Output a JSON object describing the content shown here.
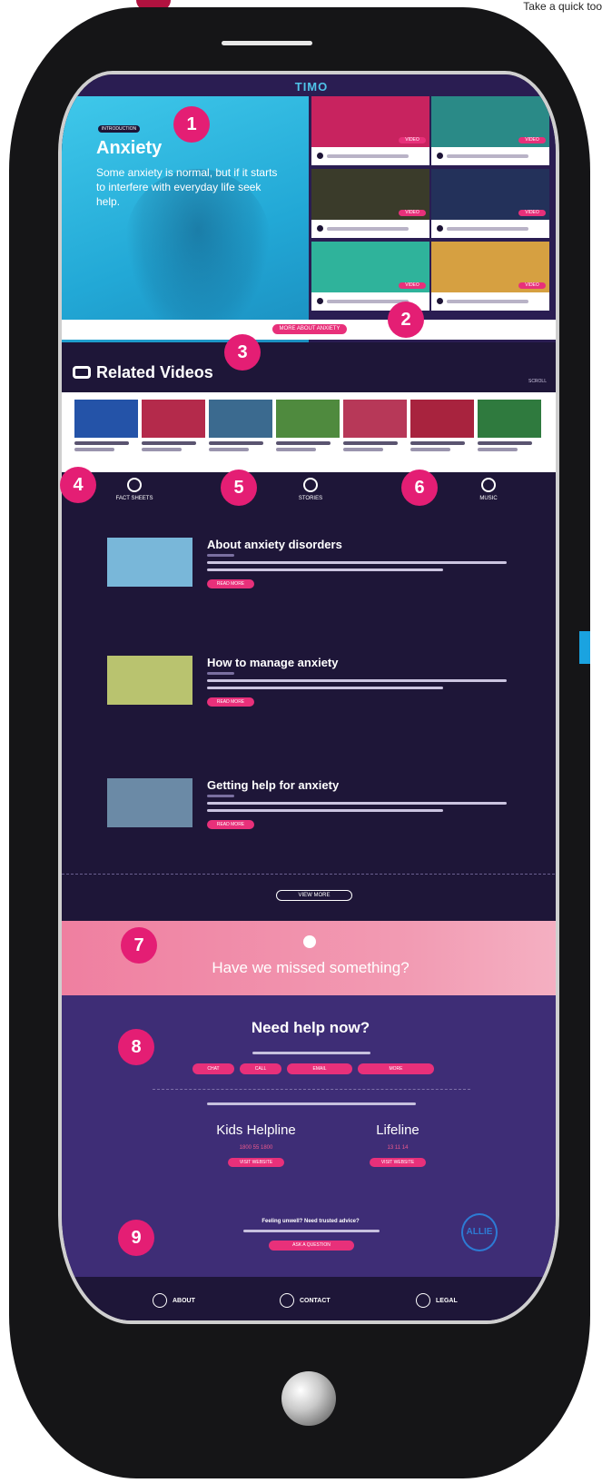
{
  "top_note": "Take a quick too",
  "site": {
    "brand": "TIMO"
  },
  "hero": {
    "badge": "INTRODUCTION",
    "title": "Anxiety",
    "subtitle": "Some anxiety is normal, but if it starts to interfere with everyday life seek help.",
    "more_button": "MORE ABOUT ANXIETY"
  },
  "hero_tiles": [
    {
      "color": "#c8235f",
      "tag": "VIDEO"
    },
    {
      "color": "#2a8a87",
      "tag": "VIDEO"
    },
    {
      "color": "#3a3b2a",
      "tag": "VIDEO"
    },
    {
      "color": "#23315a",
      "tag": "VIDEO"
    },
    {
      "color": "#2fb39b",
      "tag": "VIDEO"
    },
    {
      "color": "#d6a041",
      "tag": "VIDEO"
    }
  ],
  "related": {
    "title": "Related Videos",
    "nav": "SCROLL",
    "items": [
      {
        "color": "#2453a8"
      },
      {
        "color": "#b42a4b"
      },
      {
        "color": "#3b6a8f"
      },
      {
        "color": "#4f8a3e"
      },
      {
        "color": "#b73858"
      },
      {
        "color": "#a8233e"
      },
      {
        "color": "#2f7a3e"
      },
      {
        "color": "#c99a23"
      }
    ]
  },
  "categories": [
    {
      "label": "FACT SHEETS"
    },
    {
      "label": "STORIES"
    },
    {
      "label": "MUSIC"
    }
  ],
  "articles": [
    {
      "title": "About anxiety disorders",
      "button": "READ MORE",
      "color": "#79b7d9"
    },
    {
      "title": "How to manage anxiety",
      "button": "READ MORE",
      "color": "#b9c36f"
    },
    {
      "title": "Getting help for anxiety",
      "button": "READ MORE",
      "color": "#6b8aa6"
    }
  ],
  "view_more": "VIEW MORE",
  "missed": {
    "text": "Have we missed something?"
  },
  "help": {
    "title": "Need help now?",
    "pills": [
      "CHAT",
      "CALL",
      "EMAIL",
      "MORE"
    ],
    "orgs": [
      {
        "name": "Kids Helpline",
        "phone": "1800 55 1800",
        "button": "VISIT WEBSITE"
      },
      {
        "name": "Lifeline",
        "phone": "13 11 14",
        "button": "VISIT WEBSITE"
      }
    ],
    "feeling": "Feeling unwell? Need trusted advice?",
    "feeling_button": "ASK A QUESTION",
    "allie": "ALLIE"
  },
  "footer": {
    "items": [
      "ABOUT",
      "CONTACT",
      "LEGAL"
    ]
  },
  "markers": [
    "1",
    "2",
    "3",
    "4",
    "5",
    "6",
    "7",
    "8",
    "9"
  ]
}
